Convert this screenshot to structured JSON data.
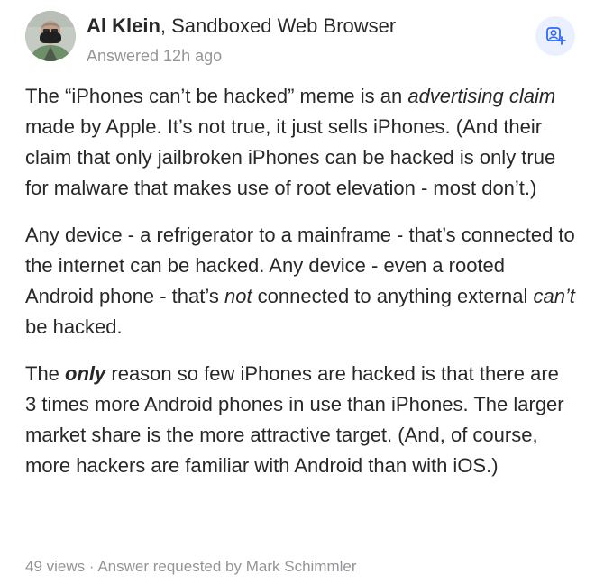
{
  "author": {
    "name": "Al Klein",
    "credential": ", Sandboxed Web Browser",
    "answered": "Answered 12h ago"
  },
  "share_button": {
    "icon": "user-add-icon",
    "color": "#2e69ff"
  },
  "answer": {
    "p1": {
      "a": "The “iPhones can’t be hacked” meme is an ",
      "em": "advertising claim",
      "b": " made by Apple. It’s not true, it just sells iPhones. (And their claim that only jailbroken iPhones can be hacked is only true for malware that makes use of root elevation - most don’t.)"
    },
    "p2": {
      "a": "Any device - a refrigerator to a mainframe - that’s connected to the internet can be hacked. Any device - even a rooted Android phone - that’s ",
      "em1": "not",
      "b": " connected to anything external ",
      "em2": "can’t",
      "c": " be hacked."
    },
    "p3": {
      "a": "The ",
      "strong": "only",
      "b": " reason so few iPhones are hacked is that there are 3 times more Android phones in use than iPhones. The larger market share is the more attractive target. (And, of course, more hackers are familiar with Android than with iOS.)"
    }
  },
  "footer": {
    "views": "49 views",
    "separator": " · ",
    "requested": "Answer requested by Mark Schimmler"
  },
  "colors": {
    "text": "#282829",
    "muted": "#939598",
    "accent": "#2e69ff"
  }
}
